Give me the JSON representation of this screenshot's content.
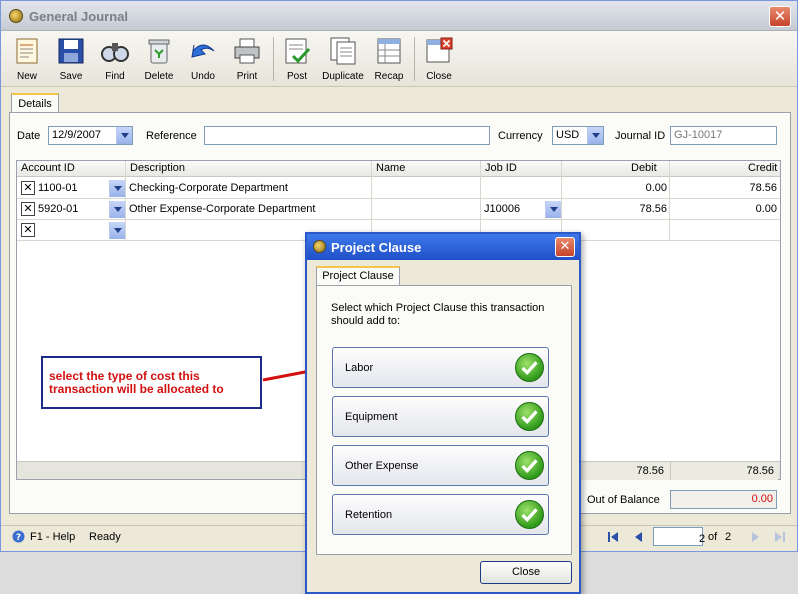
{
  "window": {
    "title": "General Journal"
  },
  "toolbar": {
    "buttons": [
      {
        "label": "New",
        "icon": "new-icon"
      },
      {
        "label": "Save",
        "icon": "save-icon"
      },
      {
        "label": "Find",
        "icon": "find-icon"
      },
      {
        "label": "Delete",
        "icon": "delete-icon"
      },
      {
        "label": "Undo",
        "icon": "undo-icon"
      },
      {
        "label": "Print",
        "icon": "print-icon"
      },
      {
        "label": "Post",
        "icon": "post-icon"
      },
      {
        "label": "Duplicate",
        "icon": "duplicate-icon"
      },
      {
        "label": "Recap",
        "icon": "recap-icon"
      },
      {
        "label": "Close",
        "icon": "close-icon"
      }
    ]
  },
  "tabs": {
    "details": "Details"
  },
  "form": {
    "date_label": "Date",
    "date_value": "12/9/2007",
    "reference_label": "Reference",
    "reference_value": "",
    "currency_label": "Currency",
    "currency_value": "USD",
    "journal_label": "Journal ID",
    "journal_value": "GJ-10017"
  },
  "grid": {
    "headers": [
      "Account ID",
      "Description",
      "Name",
      "Job ID",
      "Debit",
      "Credit"
    ],
    "rows": [
      {
        "account": "1100-01",
        "description": "Checking-Corporate Department",
        "name": "",
        "job": "",
        "debit": "0.00",
        "credit": "78.56"
      },
      {
        "account": "5920-01",
        "description": "Other Expense-Corporate Department",
        "name": "",
        "job": "J10006",
        "debit": "78.56",
        "credit": "0.00"
      },
      {
        "account": "",
        "description": "",
        "name": "",
        "job": "",
        "debit": "",
        "credit": ""
      }
    ],
    "total_debit": "78.56",
    "total_credit": "78.56",
    "out_of_balance_label": "Out of Balance",
    "out_of_balance_value": "0.00"
  },
  "statusbar": {
    "help": "F1 - Help",
    "status": "Ready",
    "page": "2",
    "of_label": "of",
    "total_pages": "2"
  },
  "dialog": {
    "title": "Project Clause",
    "tab": "Project Clause",
    "prompt": "Select which Project Clause this transaction should add to:",
    "choices": [
      "Labor",
      "Equipment",
      "Other Expense",
      "Retention"
    ],
    "close_label": "Close"
  },
  "annotation": {
    "text": "select the type of cost this transaction will be allocated to",
    "color": "#d21010"
  },
  "colors": {
    "dialog_title": "#1f4fc8",
    "accent": "#f3c54d",
    "balance": "#d21010"
  }
}
